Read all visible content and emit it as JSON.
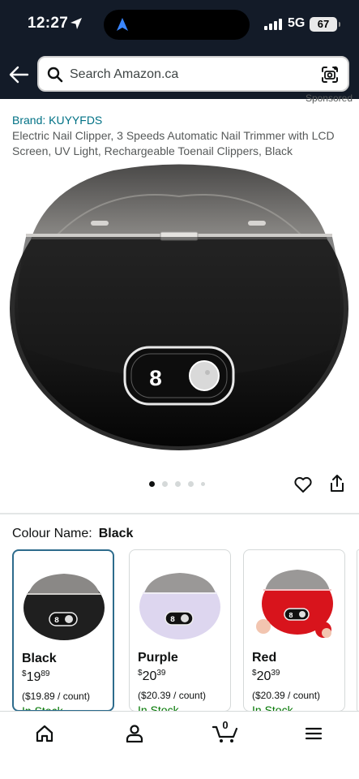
{
  "status_bar": {
    "time": "12:27",
    "network": "5G",
    "battery": "67"
  },
  "header": {
    "search_placeholder": "Search Amazon.ca"
  },
  "product": {
    "sponsored_label": "Sponsored",
    "brand": "Brand: KUYYFDS",
    "title": "Electric Nail Clipper, 3 Speeds Automatic Nail Trimmer with LCD Screen, UV Light, Rechargeable Toenail Clippers, Black",
    "display_digit": "8",
    "image_count": 5,
    "active_image_index": 0
  },
  "variations": {
    "label": "Colour Name:",
    "selected": "Black",
    "options": [
      {
        "name": "Black",
        "price_whole": "19",
        "price_fraction": "89",
        "currency": "$",
        "per_unit": "($19.89 / count)",
        "stock": "In Stock",
        "body_color": "#1f1f1f"
      },
      {
        "name": "Purple",
        "price_whole": "20",
        "price_fraction": "39",
        "currency": "$",
        "per_unit": "($20.39 / count)",
        "stock": "In Stock",
        "body_color": "#ddd6ef"
      },
      {
        "name": "Red",
        "price_whole": "20",
        "price_fraction": "39",
        "currency": "$",
        "per_unit": "($20.39 / count)",
        "stock": "In Stock",
        "body_color": "#d8141c"
      }
    ]
  },
  "bottom_nav": {
    "items": [
      "home",
      "account",
      "cart",
      "menu"
    ],
    "cart_count": "0"
  },
  "colors": {
    "header_bg": "#131b28",
    "link": "#007185",
    "in_stock": "#007600",
    "selected_border": "#2d6b8c"
  }
}
